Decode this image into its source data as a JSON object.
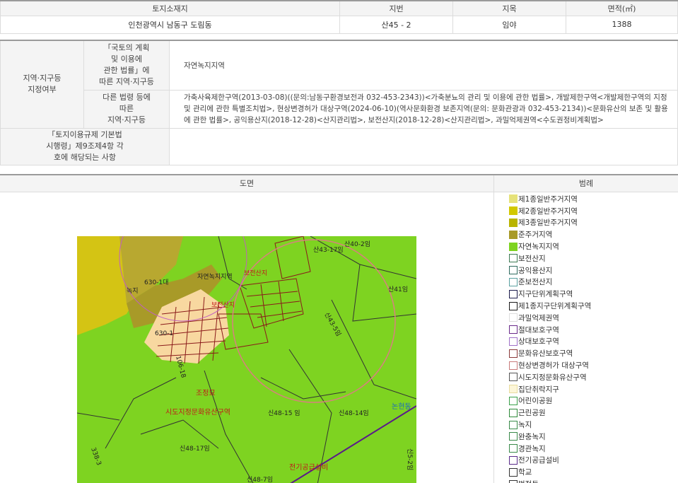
{
  "land_table": {
    "headers": [
      "토지소재지",
      "지번",
      "지목",
      "면적(㎡)"
    ],
    "row": [
      "인천광역시 남동구 도림동",
      "산45 - 2",
      "임야",
      "1388"
    ]
  },
  "zoning": {
    "row_header": "지역·지구등\n지정여부",
    "national_plan_label": "「국토의 계획\n및 이용에\n관한 법률」에\n따른 지역·지구등",
    "national_plan_value": "자연녹지지역",
    "other_laws_label": "다른 법령 등에\n따른\n지역·지구등",
    "other_laws_value": "가축사육제한구역(2013-03-08)((문의:남동구환경보전과 032-453-2343))<가축분뇨의 관리 및 이용에 관한 법률>, 개발제한구역<개발제한구역의 지정 및 관리에 관한 특별조치법>, 현상변경허가 대상구역(2024-06-10)(역사문화환경 보존지역(문의: 문화관광과 032-453-2134))<문화유산의 보존 및 활용에 관한 법률>, 공익용산지(2018-12-28)<산지관리법>, 보전산지(2018-12-28)<산지관리법>, 과밀억제권역<수도권정비계획법>",
    "enforcement_label": "「토지이용규제 기본법\n시행령」제9조제4항 각\n호에 해당되는 사항",
    "enforcement_value": ""
  },
  "map_section": {
    "map_header": "도면",
    "legend_header": "범례",
    "map_labels": [
      "산40-2임",
      "산43-17임",
      "산41임",
      "630-1대",
      "자연녹지지역",
      "보전산지",
      "신48-15 임",
      "신48-14임",
      "신48-17임",
      "신5-2임",
      "신48-7임",
      "전기공급설비",
      "논현동",
      "녹지",
      "630-1",
      "보전산지",
      "조정묘",
      "시도지정문화유산구역",
      "산43-5임",
      "106-18",
      "338-3"
    ]
  },
  "legend": [
    {
      "label": "제1종일반주거지역",
      "color": "#e6e27a",
      "border": "#e6e27a"
    },
    {
      "label": "제2종일반주거지역",
      "color": "#d2c800",
      "border": "#d2c800"
    },
    {
      "label": "제3종일반주거지역",
      "color": "#b9b400",
      "border": "#b9b400"
    },
    {
      "label": "준주거지역",
      "color": "#a89a28",
      "border": "#a89a28"
    },
    {
      "label": "자연녹지지역",
      "color": "#7ed321",
      "border": "#7ed321"
    },
    {
      "label": "보전산지",
      "color": "#ffffff",
      "border": "#3d7a52"
    },
    {
      "label": "공익용산지",
      "color": "#ffffff",
      "border": "#2f6b5e"
    },
    {
      "label": "준보전산지",
      "color": "#ffffff",
      "border": "#5aa0a0"
    },
    {
      "label": "지구단위계획구역",
      "color": "#ffffff",
      "border": "#1a1a4a"
    },
    {
      "label": "제1종지구단위계획구역",
      "color": "#ffffff",
      "border": "#1a1a1a"
    },
    {
      "label": "과밀억제권역",
      "color": "#ffffff",
      "border": "#dddddd"
    },
    {
      "label": "절대보호구역",
      "color": "#ffffff",
      "border": "#6a2a8a"
    },
    {
      "label": "상대보호구역",
      "color": "#ffffff",
      "border": "#a070c8"
    },
    {
      "label": "문화유산보호구역",
      "color": "#ffffff",
      "border": "#8a3a3a"
    },
    {
      "label": "현상변경허가 대상구역",
      "color": "#ffffff",
      "border": "#c87a7a"
    },
    {
      "label": "시도지정문화유산구역",
      "color": "#ffffff",
      "border": "#555555"
    },
    {
      "label": "집단취락지구",
      "color": "#fdf6d8",
      "border": "#e8dca0"
    },
    {
      "label": "어린이공원",
      "color": "#ffffff",
      "border": "#3aa04a"
    },
    {
      "label": "근린공원",
      "color": "#ffffff",
      "border": "#2e8a3a"
    },
    {
      "label": "녹지",
      "color": "#ffffff",
      "border": "#3a8a4a"
    },
    {
      "label": "완충녹지",
      "color": "#ffffff",
      "border": "#3a8a4a"
    },
    {
      "label": "경관녹지",
      "color": "#ffffff",
      "border": "#3a8a4a"
    },
    {
      "label": "전기공급설비",
      "color": "#ffffff",
      "border": "#5a2a8a"
    },
    {
      "label": "학교",
      "color": "#ffffff",
      "border": "#333333"
    },
    {
      "label": "법정동",
      "color": "#ffffff",
      "border": "#333333"
    }
  ]
}
